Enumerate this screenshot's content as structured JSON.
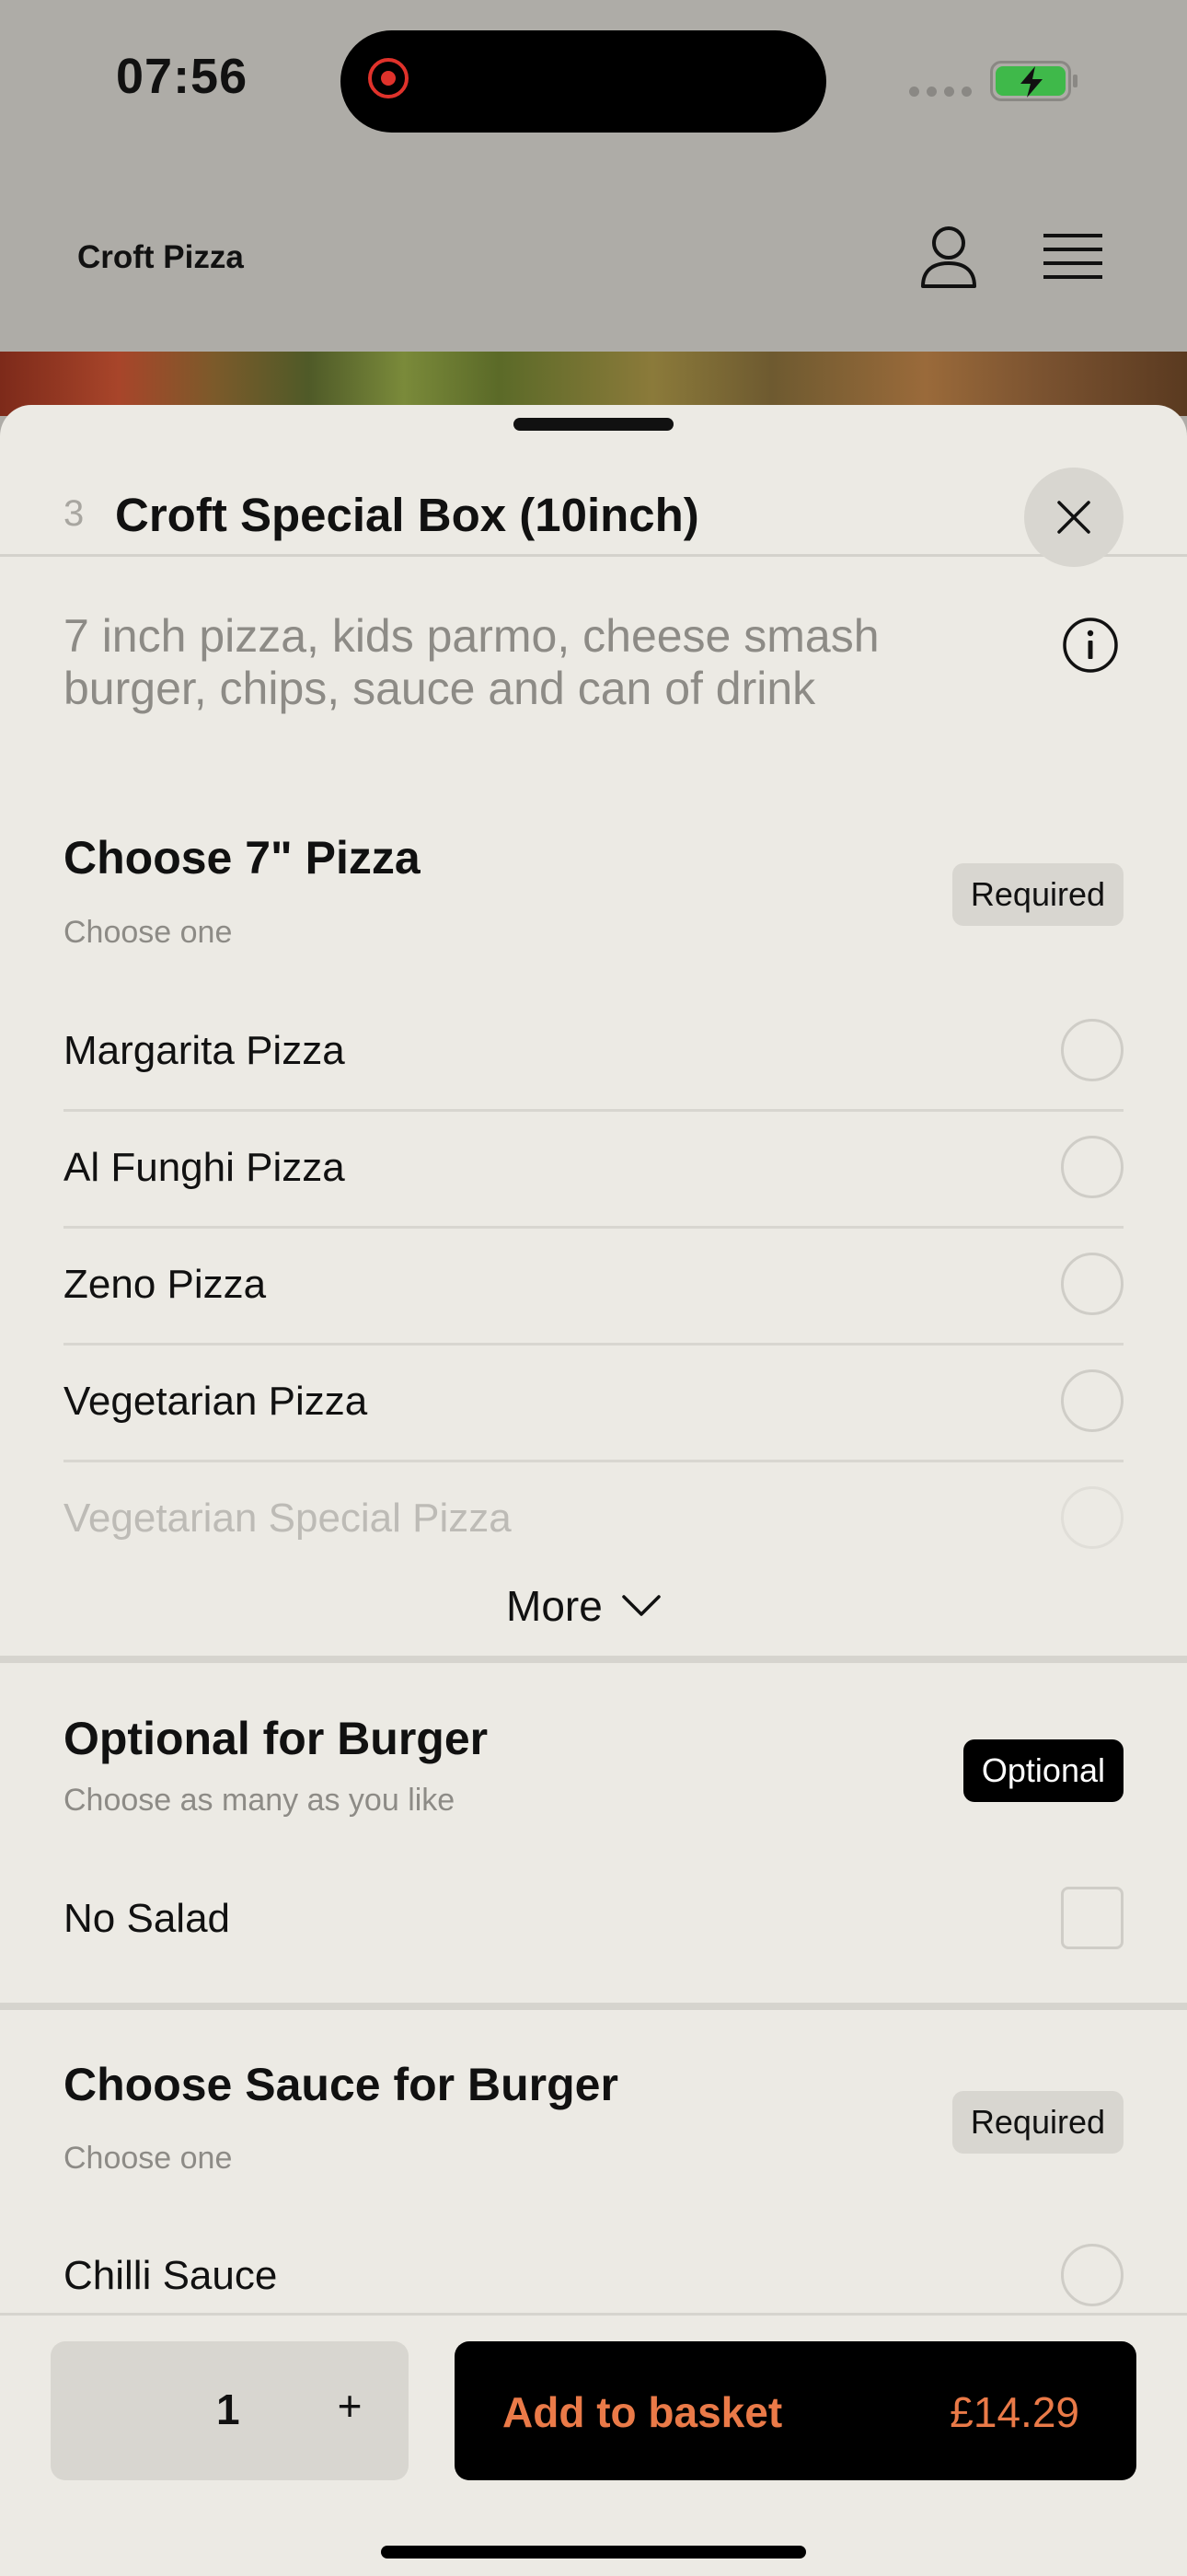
{
  "status_bar": {
    "time": "07:56"
  },
  "app_header": {
    "brand": "Croft Pizza"
  },
  "sheet": {
    "item_number": "3",
    "title": "Croft Special Box (10inch)",
    "description": "7 inch pizza, kids parmo, cheese smash burger, chips, sauce and can of drink"
  },
  "sections": [
    {
      "title": "Choose 7\" Pizza",
      "subtitle": "Choose one",
      "badge": "Required",
      "options": [
        "Margarita Pizza",
        "Al Funghi Pizza",
        "Zeno Pizza",
        "Vegetarian Pizza",
        "Vegetarian Special Pizza"
      ],
      "more_label": "More"
    },
    {
      "title": "Optional for Burger",
      "subtitle": "Choose as many as you like",
      "badge": "Optional",
      "options": [
        "No Salad"
      ]
    },
    {
      "title": "Choose Sauce for Burger",
      "subtitle": "Choose one",
      "badge": "Required",
      "options": [
        "Chilli Sauce"
      ]
    }
  ],
  "footer": {
    "quantity": "1",
    "plus_label": "+",
    "add_label": "Add to basket",
    "price": "£14.29"
  },
  "colors": {
    "accent": "#ea7a48",
    "sheet_background": "#eceae4",
    "dimmed_background": "#aeaca7"
  }
}
